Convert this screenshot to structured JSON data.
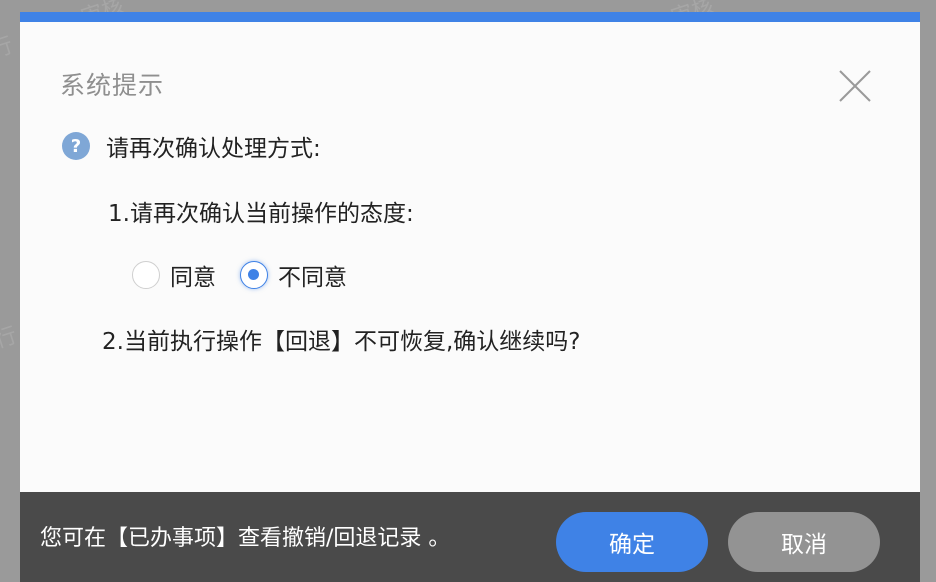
{
  "dialog": {
    "title": "系统提示",
    "accent_color": "#3f82e6",
    "close_icon": "close-icon"
  },
  "question": {
    "icon": "question-icon",
    "icon_glyph": "?",
    "text": "请再次确认处理方式:"
  },
  "item1": {
    "text": "1.请再次确认当前操作的态度:",
    "options": [
      {
        "label": "同意",
        "selected": false
      },
      {
        "label": "不同意",
        "selected": true
      }
    ]
  },
  "item2": {
    "text": "2.当前执行操作【回退】不可恢复,确认继续吗?"
  },
  "footer": {
    "note": "您可在【已办事项】查看撤销/回退记录 。",
    "confirm_label": "确定",
    "cancel_label": "取消"
  }
}
